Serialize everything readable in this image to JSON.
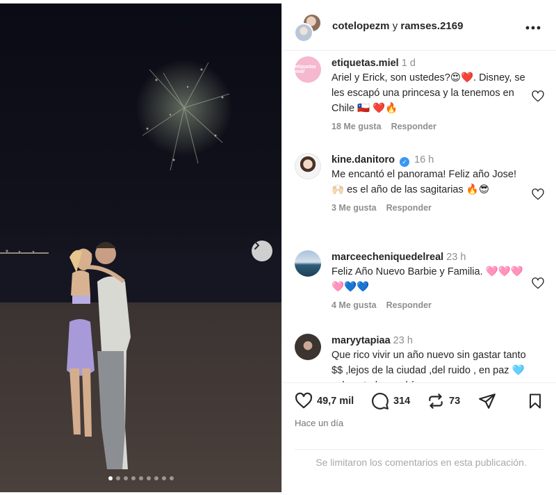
{
  "header": {
    "user1": "cotelopezm",
    "joiner": "y",
    "user2": "ramses.2169",
    "more_icon": "more-horizontal-icon"
  },
  "photo": {
    "carousel_dots": 9,
    "active_dot": 0,
    "next_icon": "chevron-right-icon"
  },
  "comments": [
    {
      "username": "etiquetas.miel",
      "time": "1 d",
      "text": "Ariel y Erick, son ustedes?😍❤️. Disney, se les escapó una princesa y la tenemos en Chile 🇨🇱 ❤️🔥",
      "likes": "18 Me gusta",
      "reply": "Responder",
      "avatar_text": "etiquetas miel"
    },
    {
      "username": "kine.danitoro",
      "verified": true,
      "time": "16 h",
      "text": "Me encantó el panorama! Feliz año Jose! 🙌🏻 es el año de las sagitarias 🔥😎",
      "likes": "3 Me gusta",
      "reply": "Responder"
    },
    {
      "username": "marceecheniquedelreal",
      "time": "23 h",
      "text": "Feliz Año Nuevo Barbie y Familia. 🩷🩷🩷🩷💙💙",
      "likes": "4 Me gusta",
      "reply": "Responder"
    },
    {
      "username": "maryytapiaa",
      "time": "23 h",
      "text": "Que rico vivir un año nuevo sin gastar tanto $$ ,lejos de la ciudad ,del ruido , en paz 🩵 solo ustedes podrían",
      "likes": "",
      "reply": ""
    }
  ],
  "actions": {
    "likes": "49,7 mil",
    "comments": "314",
    "reposts": "73"
  },
  "time_ago": "Hace un día",
  "limited_notice": "Se limitaron los comentarios en esta publicación."
}
